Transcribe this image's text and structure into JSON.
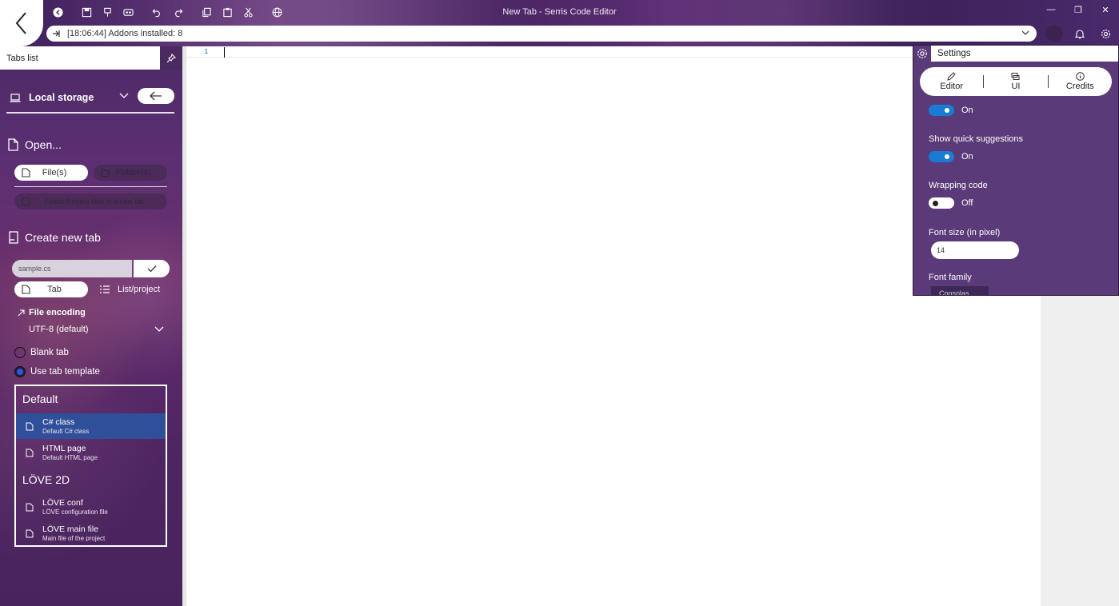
{
  "window": {
    "title": "New Tab - Serris Code Editor",
    "controls": {
      "minimize": "—",
      "restore": "❐",
      "close": "✕"
    }
  },
  "addressbar": {
    "text": "[18:06:44] Addons installed: 8"
  },
  "left_panel": {
    "header": "Tabs list",
    "storage": "Local storage",
    "open_title": "Open...",
    "files_button": "File(s)",
    "folder_button": "Folder(s)",
    "folder_project_button": "Folder/Project files in a new list",
    "create_title": "Create new tab",
    "filename_value": "sample.cs",
    "tab_button": "Tab",
    "list_project_button": "List/project",
    "encoding_label": "File encoding",
    "encoding_value": "UTF-8 (default)",
    "blank_tab": "Blank tab",
    "use_template": "Use tab template",
    "templates": {
      "group1": "Default",
      "item1_title": "C# class",
      "item1_sub": "Default C# class",
      "item2_title": "HTML page",
      "item2_sub": "Default HTML page",
      "group2": "LÖVE 2D",
      "item3_title": "LÖVE conf",
      "item3_sub": "LÖVE configuration file",
      "item4_title": "LÖVE main file",
      "item4_sub": "Main file of the project"
    }
  },
  "editor": {
    "line_number": "1"
  },
  "settings": {
    "title": "Settings",
    "tabs": {
      "editor": "Editor",
      "ui": "UI",
      "credits": "Credits"
    },
    "toggle1_state": "On",
    "quick_suggestions_label": "Show quick suggestions",
    "quick_suggestions_state": "On",
    "wrapping_label": "Wrapping code",
    "wrapping_state": "Off",
    "font_size_label": "Font size (in pixel)",
    "font_size_value": "14",
    "font_family_label": "Font family",
    "font_family_value": "Consolas"
  },
  "colors": {
    "accent": "#1a7bd4",
    "panel": "#5a3a78",
    "selected_item": "#2f4f9a"
  }
}
